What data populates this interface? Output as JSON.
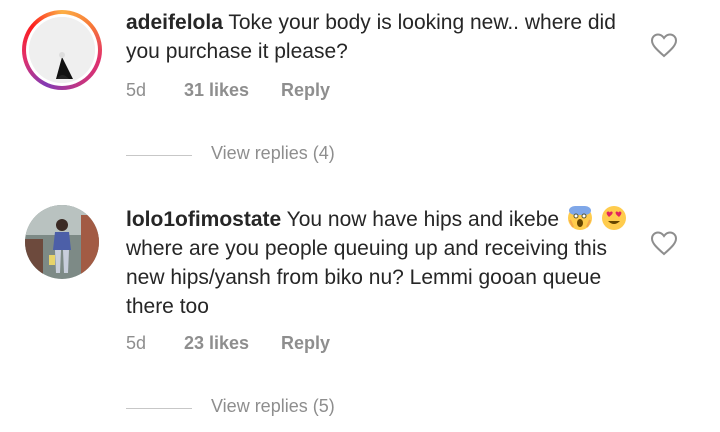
{
  "comments": [
    {
      "username": "adeifelola",
      "text": "Toke your body is looking new.. where did you purchase it please?",
      "time": "5d",
      "likes": "31 likes",
      "reply_label": "Reply",
      "view_replies": "View replies (4)",
      "avatar": "profile-photo-story-ring",
      "emoji": []
    },
    {
      "username": "lolo1ofimostate",
      "text": "You now have hips and ikebe",
      "text_after_emoji": "where are you people queuing up and receiving this new hips/yansh from biko nu? Lemmi gooan queue there too",
      "time": "5d",
      "likes": "23 likes",
      "reply_label": "Reply",
      "view_replies": "View replies (5)",
      "avatar": "profile-photo",
      "emoji": [
        "face-screaming-in-fear",
        "smiling-face-with-heart-eyes"
      ]
    }
  ],
  "colors": {
    "text": "#262626",
    "secondary": "#8e8e8e",
    "divider": "#c7c7c7",
    "heart_outline": "#8e8e8e"
  },
  "icons": [
    "heart-outline-icon"
  ]
}
